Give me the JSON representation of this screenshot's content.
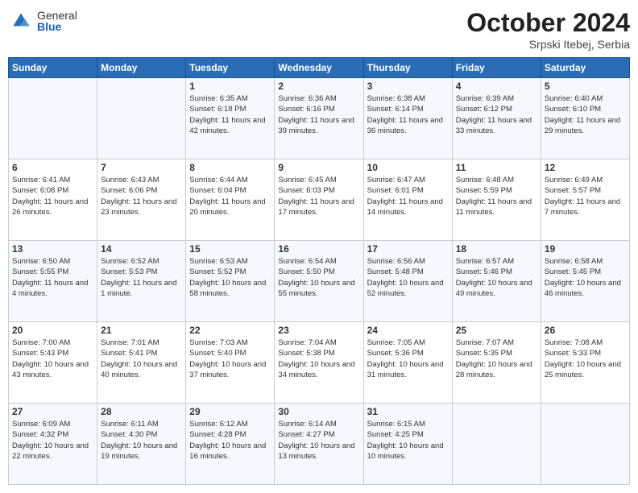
{
  "header": {
    "logo_general": "General",
    "logo_blue": "Blue",
    "month_title": "October 2024",
    "location": "Srpski Itebej, Serbia"
  },
  "weekdays": [
    "Sunday",
    "Monday",
    "Tuesday",
    "Wednesday",
    "Thursday",
    "Friday",
    "Saturday"
  ],
  "weeks": [
    [
      {
        "day": "",
        "sunrise": "",
        "sunset": "",
        "daylight": ""
      },
      {
        "day": "",
        "sunrise": "",
        "sunset": "",
        "daylight": ""
      },
      {
        "day": "1",
        "sunrise": "Sunrise: 6:35 AM",
        "sunset": "Sunset: 6:18 PM",
        "daylight": "Daylight: 11 hours and 42 minutes."
      },
      {
        "day": "2",
        "sunrise": "Sunrise: 6:36 AM",
        "sunset": "Sunset: 6:16 PM",
        "daylight": "Daylight: 11 hours and 39 minutes."
      },
      {
        "day": "3",
        "sunrise": "Sunrise: 6:38 AM",
        "sunset": "Sunset: 6:14 PM",
        "daylight": "Daylight: 11 hours and 36 minutes."
      },
      {
        "day": "4",
        "sunrise": "Sunrise: 6:39 AM",
        "sunset": "Sunset: 6:12 PM",
        "daylight": "Daylight: 11 hours and 33 minutes."
      },
      {
        "day": "5",
        "sunrise": "Sunrise: 6:40 AM",
        "sunset": "Sunset: 6:10 PM",
        "daylight": "Daylight: 11 hours and 29 minutes."
      }
    ],
    [
      {
        "day": "6",
        "sunrise": "Sunrise: 6:41 AM",
        "sunset": "Sunset: 6:08 PM",
        "daylight": "Daylight: 11 hours and 26 minutes."
      },
      {
        "day": "7",
        "sunrise": "Sunrise: 6:43 AM",
        "sunset": "Sunset: 6:06 PM",
        "daylight": "Daylight: 11 hours and 23 minutes."
      },
      {
        "day": "8",
        "sunrise": "Sunrise: 6:44 AM",
        "sunset": "Sunset: 6:04 PM",
        "daylight": "Daylight: 11 hours and 20 minutes."
      },
      {
        "day": "9",
        "sunrise": "Sunrise: 6:45 AM",
        "sunset": "Sunset: 6:03 PM",
        "daylight": "Daylight: 11 hours and 17 minutes."
      },
      {
        "day": "10",
        "sunrise": "Sunrise: 6:47 AM",
        "sunset": "Sunset: 6:01 PM",
        "daylight": "Daylight: 11 hours and 14 minutes."
      },
      {
        "day": "11",
        "sunrise": "Sunrise: 6:48 AM",
        "sunset": "Sunset: 5:59 PM",
        "daylight": "Daylight: 11 hours and 11 minutes."
      },
      {
        "day": "12",
        "sunrise": "Sunrise: 6:49 AM",
        "sunset": "Sunset: 5:57 PM",
        "daylight": "Daylight: 11 hours and 7 minutes."
      }
    ],
    [
      {
        "day": "13",
        "sunrise": "Sunrise: 6:50 AM",
        "sunset": "Sunset: 5:55 PM",
        "daylight": "Daylight: 11 hours and 4 minutes."
      },
      {
        "day": "14",
        "sunrise": "Sunrise: 6:52 AM",
        "sunset": "Sunset: 5:53 PM",
        "daylight": "Daylight: 11 hours and 1 minute."
      },
      {
        "day": "15",
        "sunrise": "Sunrise: 6:53 AM",
        "sunset": "Sunset: 5:52 PM",
        "daylight": "Daylight: 10 hours and 58 minutes."
      },
      {
        "day": "16",
        "sunrise": "Sunrise: 6:54 AM",
        "sunset": "Sunset: 5:50 PM",
        "daylight": "Daylight: 10 hours and 55 minutes."
      },
      {
        "day": "17",
        "sunrise": "Sunrise: 6:56 AM",
        "sunset": "Sunset: 5:48 PM",
        "daylight": "Daylight: 10 hours and 52 minutes."
      },
      {
        "day": "18",
        "sunrise": "Sunrise: 6:57 AM",
        "sunset": "Sunset: 5:46 PM",
        "daylight": "Daylight: 10 hours and 49 minutes."
      },
      {
        "day": "19",
        "sunrise": "Sunrise: 6:58 AM",
        "sunset": "Sunset: 5:45 PM",
        "daylight": "Daylight: 10 hours and 46 minutes."
      }
    ],
    [
      {
        "day": "20",
        "sunrise": "Sunrise: 7:00 AM",
        "sunset": "Sunset: 5:43 PM",
        "daylight": "Daylight: 10 hours and 43 minutes."
      },
      {
        "day": "21",
        "sunrise": "Sunrise: 7:01 AM",
        "sunset": "Sunset: 5:41 PM",
        "daylight": "Daylight: 10 hours and 40 minutes."
      },
      {
        "day": "22",
        "sunrise": "Sunrise: 7:03 AM",
        "sunset": "Sunset: 5:40 PM",
        "daylight": "Daylight: 10 hours and 37 minutes."
      },
      {
        "day": "23",
        "sunrise": "Sunrise: 7:04 AM",
        "sunset": "Sunset: 5:38 PM",
        "daylight": "Daylight: 10 hours and 34 minutes."
      },
      {
        "day": "24",
        "sunrise": "Sunrise: 7:05 AM",
        "sunset": "Sunset: 5:36 PM",
        "daylight": "Daylight: 10 hours and 31 minutes."
      },
      {
        "day": "25",
        "sunrise": "Sunrise: 7:07 AM",
        "sunset": "Sunset: 5:35 PM",
        "daylight": "Daylight: 10 hours and 28 minutes."
      },
      {
        "day": "26",
        "sunrise": "Sunrise: 7:08 AM",
        "sunset": "Sunset: 5:33 PM",
        "daylight": "Daylight: 10 hours and 25 minutes."
      }
    ],
    [
      {
        "day": "27",
        "sunrise": "Sunrise: 6:09 AM",
        "sunset": "Sunset: 4:32 PM",
        "daylight": "Daylight: 10 hours and 22 minutes."
      },
      {
        "day": "28",
        "sunrise": "Sunrise: 6:11 AM",
        "sunset": "Sunset: 4:30 PM",
        "daylight": "Daylight: 10 hours and 19 minutes."
      },
      {
        "day": "29",
        "sunrise": "Sunrise: 6:12 AM",
        "sunset": "Sunset: 4:28 PM",
        "daylight": "Daylight: 10 hours and 16 minutes."
      },
      {
        "day": "30",
        "sunrise": "Sunrise: 6:14 AM",
        "sunset": "Sunset: 4:27 PM",
        "daylight": "Daylight: 10 hours and 13 minutes."
      },
      {
        "day": "31",
        "sunrise": "Sunrise: 6:15 AM",
        "sunset": "Sunset: 4:25 PM",
        "daylight": "Daylight: 10 hours and 10 minutes."
      },
      {
        "day": "",
        "sunrise": "",
        "sunset": "",
        "daylight": ""
      },
      {
        "day": "",
        "sunrise": "",
        "sunset": "",
        "daylight": ""
      }
    ]
  ]
}
